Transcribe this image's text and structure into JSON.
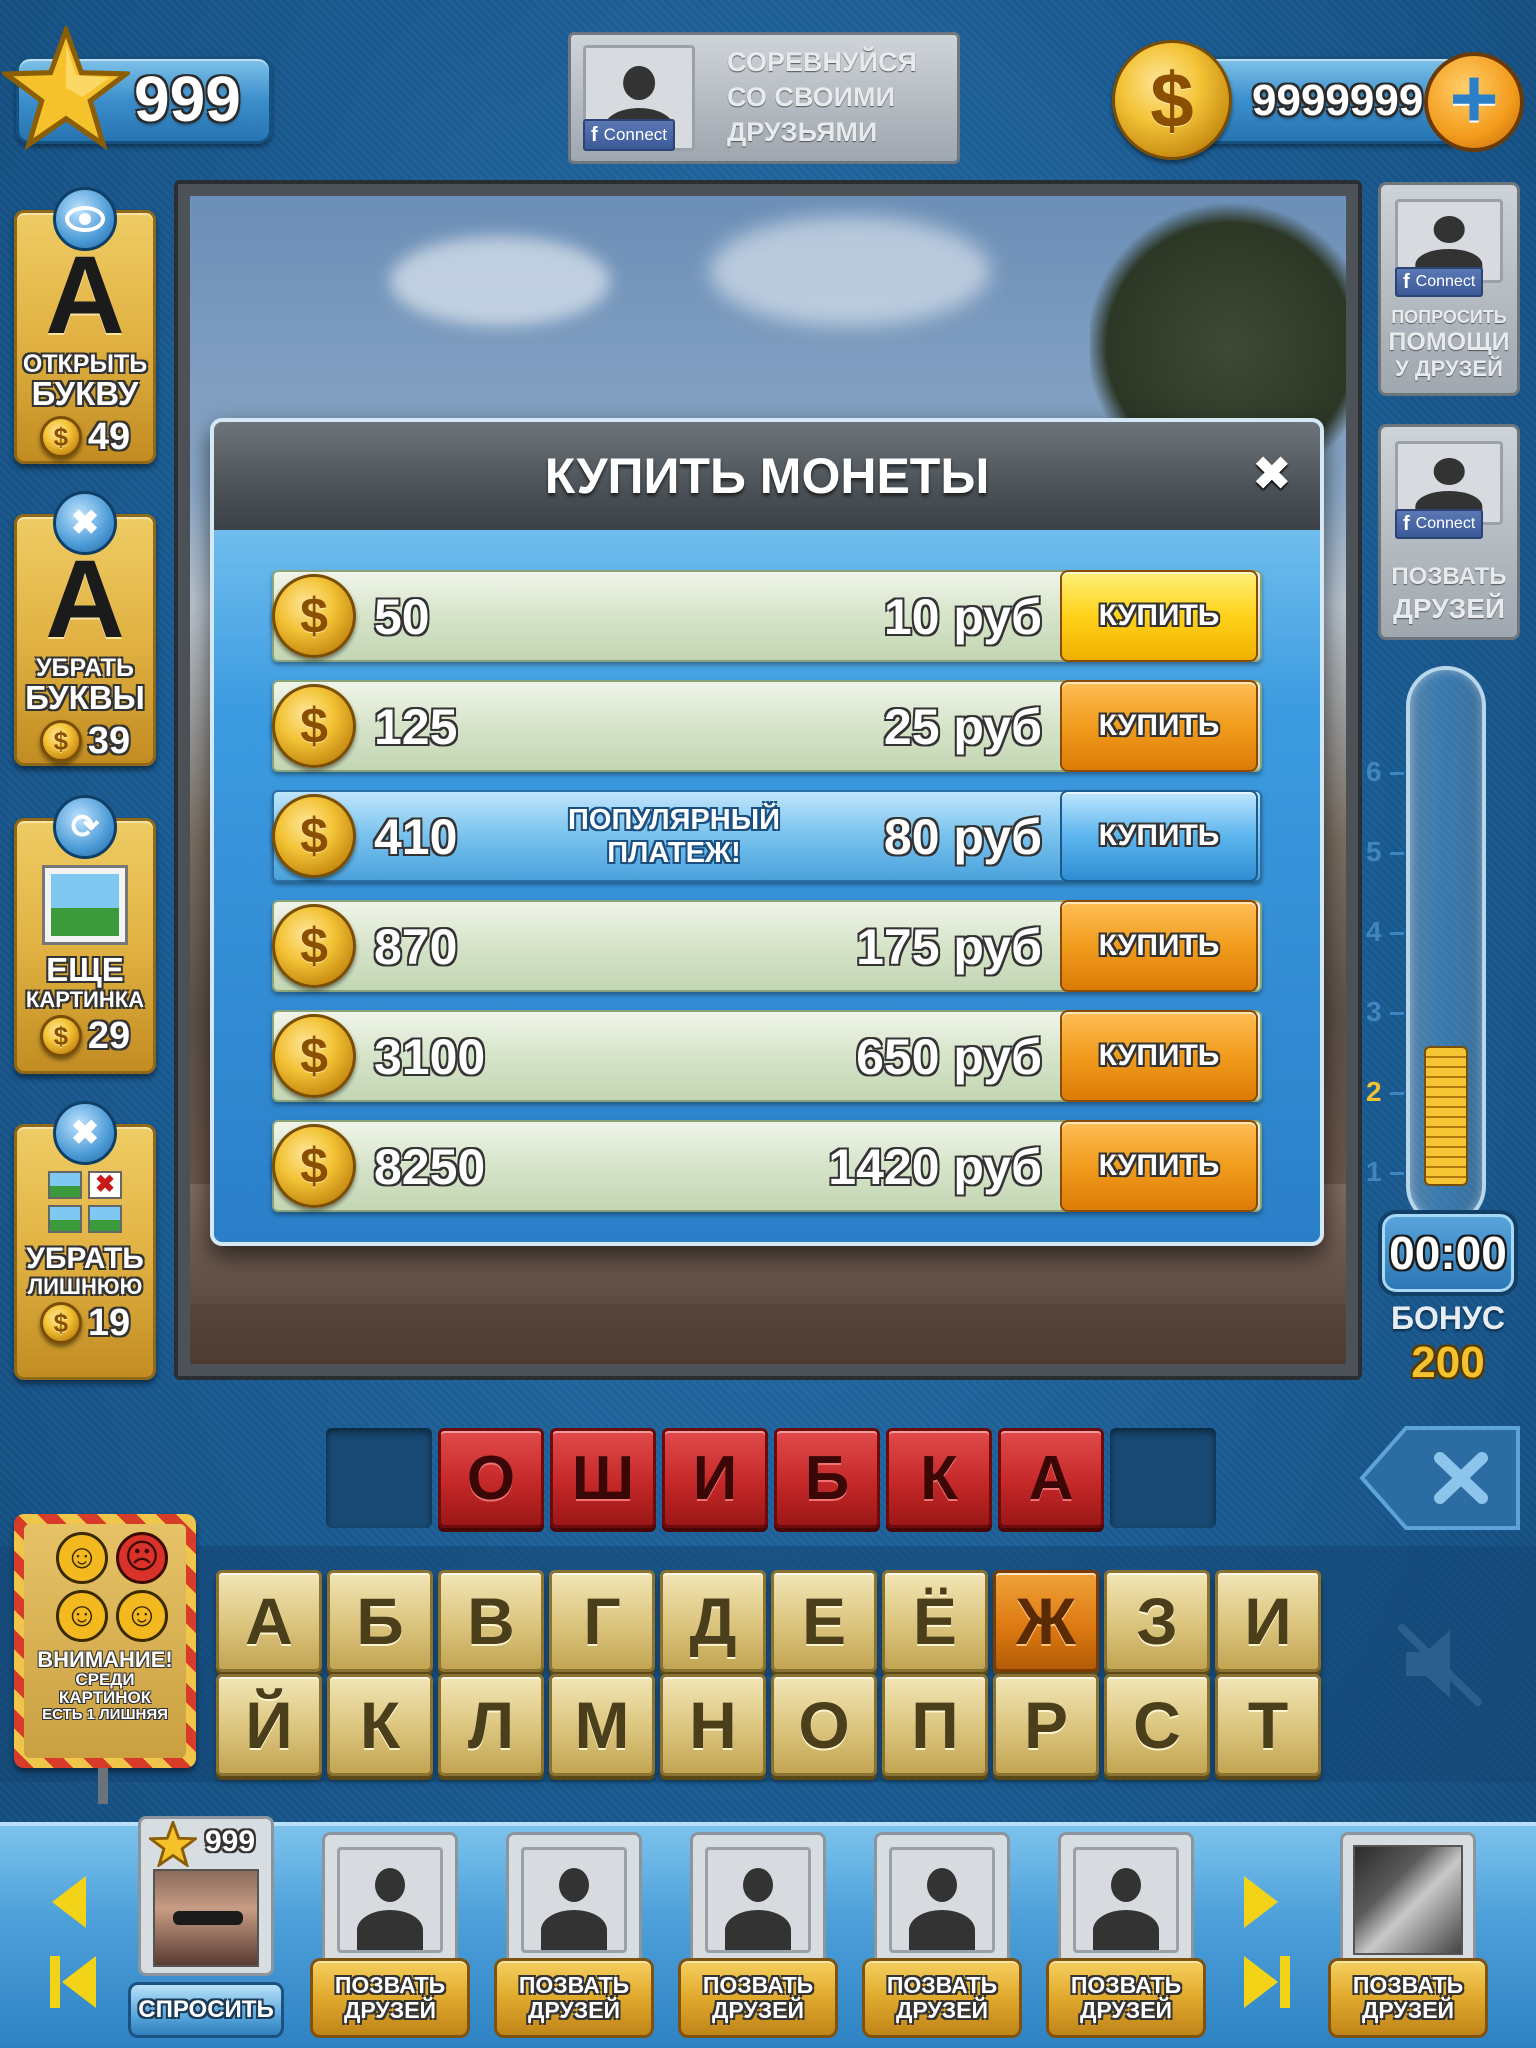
{
  "top": {
    "stars": "999",
    "competition_text": [
      "СОРЕВНУЙСЯ",
      "СО СВОИМИ",
      "ДРУЗЬЯМИ"
    ],
    "connect_label": "Connect",
    "coins": "9999999",
    "plus_symbol": "+"
  },
  "hints": [
    {
      "icon": "eye-icon",
      "letter": "A",
      "label_line1": "ОТКРЫТЬ",
      "label_line2": "БУКВУ",
      "price": "49"
    },
    {
      "icon": "remove-icon",
      "letter": "A",
      "label_line1": "УБРАТЬ",
      "label_line2": "БУКВЫ",
      "price": "39"
    },
    {
      "icon": "refresh-icon",
      "label_line1": "ЕЩЕ",
      "label_line2": "КАРТИНКА",
      "price": "29"
    },
    {
      "icon": "remove-icon",
      "label_line1": "УБРАТЬ",
      "label_line2": "ЛИШНЮЮ",
      "price": "19"
    }
  ],
  "right_panel": {
    "ask_help": {
      "connect": "Connect",
      "line1": "ПОПРОСИТЬ",
      "line2": "ПОМОЩИ",
      "line3": "У ДРУЗЕЙ"
    },
    "invite": {
      "connect": "Connect",
      "line1": "ПОЗВАТЬ",
      "line2": "ДРУЗЕЙ"
    },
    "scale": [
      "6",
      "5",
      "4",
      "3",
      "2",
      "1"
    ],
    "bonus_fill_level": 2,
    "timer": "00:00",
    "bonus_label": "БОНУС",
    "bonus_value": "200"
  },
  "modal": {
    "title": "КУПИТЬ МОНЕТЫ",
    "close_symbol": "✖",
    "popular_line1": "ПОПУЛЯРНЫЙ",
    "popular_line2": "ПЛАТЕЖ!",
    "offers": [
      {
        "amount": "50",
        "price": "10 руб",
        "button": "КУПИТЬ",
        "style": "yellow"
      },
      {
        "amount": "125",
        "price": "25 руб",
        "button": "КУПИТЬ",
        "style": "orange"
      },
      {
        "amount": "410",
        "price": "80 руб",
        "button": "КУПИТЬ",
        "style": "blue",
        "popular": true
      },
      {
        "amount": "870",
        "price": "175 руб",
        "button": "КУПИТЬ",
        "style": "orange"
      },
      {
        "amount": "3100",
        "price": "650 руб",
        "button": "КУПИТЬ",
        "style": "orange"
      },
      {
        "amount": "8250",
        "price": "1420 руб",
        "button": "КУПИТЬ",
        "style": "orange"
      }
    ]
  },
  "answer": [
    "О",
    "Ш",
    "И",
    "Б",
    "К",
    "А"
  ],
  "keyboard": {
    "row1": [
      "А",
      "Б",
      "В",
      "Г",
      "Д",
      "Е",
      "Ё",
      "Ж",
      "З",
      "И"
    ],
    "row2": [
      "Й",
      "К",
      "Л",
      "М",
      "Н",
      "О",
      "П",
      "Р",
      "С",
      "Т"
    ],
    "selected": "Ж"
  },
  "warning": {
    "title": "ВНИМАНИЕ!",
    "line1": "СРЕДИ",
    "line2": "КАРТИНОК",
    "line3": "ЕСТЬ 1 ЛИШНЯЯ"
  },
  "bottom": {
    "player_stars": "999",
    "ask_button": "СПРОСИТЬ",
    "invite_line1": "ПОЗВАТЬ",
    "invite_line2": "ДРУЗЕЙ"
  },
  "colors": {
    "background": "#1b5d94",
    "gold": "#e3b94a",
    "answer_red": "#c52828",
    "selected_orange": "#de7b12"
  }
}
